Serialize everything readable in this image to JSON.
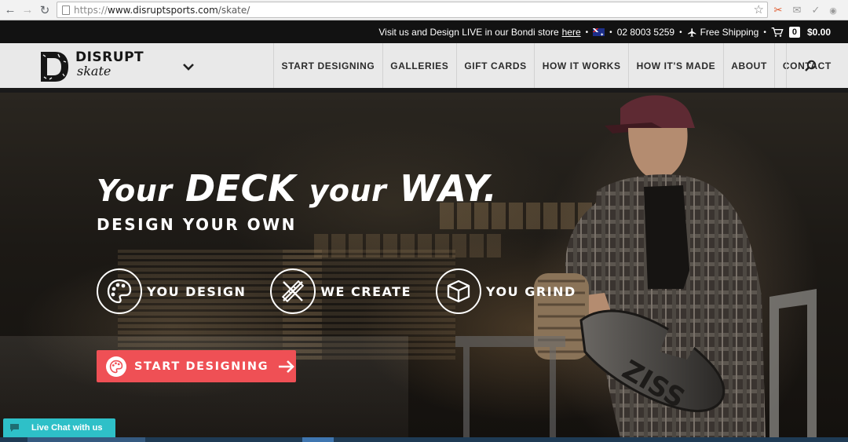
{
  "browser": {
    "url_prefix": "https://",
    "url_host": "www.disruptsports.com",
    "url_path": "/skate/"
  },
  "topbar": {
    "visit_text": "Visit us and Design LIVE in our Bondi store",
    "visit_link": "here",
    "phone": "02 8003 5259",
    "shipping": "Free Shipping",
    "cart_count": "0",
    "cart_total": "$0.00"
  },
  "logo": {
    "line1": "DISRUPT",
    "line2": "skate"
  },
  "nav": {
    "items": [
      {
        "label": "START DESIGNING"
      },
      {
        "label": "GALLERIES"
      },
      {
        "label": "GIFT CARDS"
      },
      {
        "label": "HOW IT WORKS"
      },
      {
        "label": "HOW IT'S MADE"
      },
      {
        "label": "ABOUT"
      },
      {
        "label": "CONTACT"
      }
    ]
  },
  "hero": {
    "title_w1": "Your",
    "title_w2": "DECK",
    "title_w3": "your",
    "title_w4": "WAY.",
    "subtitle": "DESIGN YOUR OWN",
    "steps": [
      {
        "label": "YOU DESIGN",
        "icon": "palette-icon"
      },
      {
        "label": "WE CREATE",
        "icon": "tools-icon"
      },
      {
        "label": "YOU GRIND",
        "icon": "box-icon"
      }
    ],
    "cta_label": "START DESIGNING"
  },
  "livechat": {
    "label": "Live Chat with us"
  },
  "colors": {
    "accent": "#ef5055",
    "chat": "#2ec0c8",
    "topbar": "#121212",
    "nav_bg": "#e9e9e9"
  }
}
